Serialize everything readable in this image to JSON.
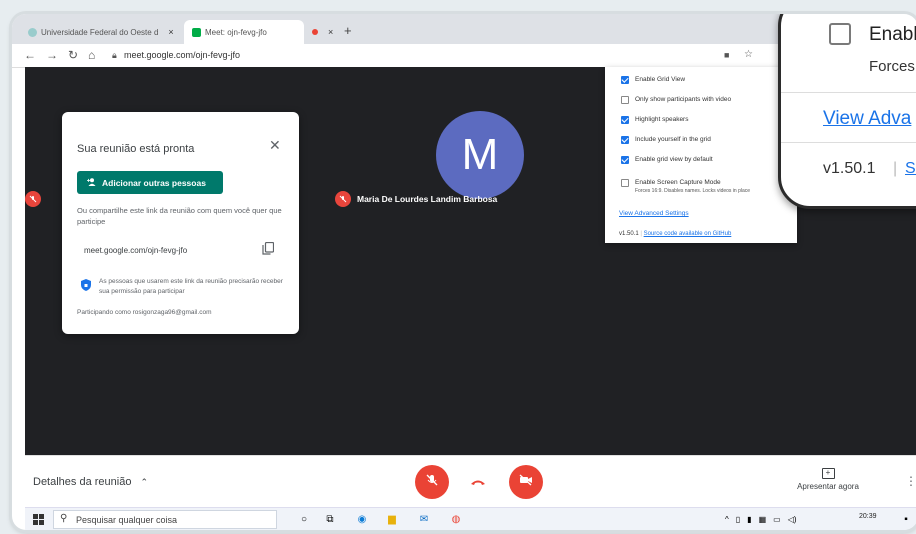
{
  "browser": {
    "tabs": [
      {
        "title": "Universidade Federal do Oeste d",
        "close": "×"
      },
      {
        "title": "Meet: ojn-fevg-jfo",
        "close": ""
      },
      {
        "title": "",
        "close": "×"
      }
    ],
    "new_tab": "+",
    "url": "meet.google.com/ojn-fevg-jfo"
  },
  "dialog": {
    "title": "Sua reunião está pronta",
    "add_button": "Adicionar outras pessoas",
    "share_text": "Ou compartilhe este link da reunião com quem você quer que participe",
    "meeting_link": "meet.google.com/ojn-fevg-jfo",
    "security_note": "As pessoas que usarem este link da reunião precisarão receber sua permissão para participar",
    "participating_as": "Participando como rosigonzaga96@gmail.com"
  },
  "participant": {
    "initial": "M",
    "name": "Maria De Lourdes Landim Barbosa"
  },
  "extension": {
    "options": [
      {
        "label": "Enable Grid View",
        "checked": true
      },
      {
        "label": "Only show participants with video",
        "checked": false
      },
      {
        "label": "Highlight speakers",
        "checked": true
      },
      {
        "label": "Include yourself in the grid",
        "checked": true
      },
      {
        "label": "Enable grid view by default",
        "checked": true
      },
      {
        "label": "Enable Screen Capture Mode",
        "checked": false,
        "sub": "Forces 16:9. Disables names. Locks videos in place"
      }
    ],
    "advanced_link": "View Advanced Settings",
    "version": "v1.50.1",
    "source_link": "Source code available on GitHub"
  },
  "zoom": {
    "enable": "Enabl",
    "forces": "Forces",
    "advanced": "View Adva",
    "version": "v1.50.1",
    "sep": "|",
    "source": "So"
  },
  "bottom_bar": {
    "details": "Detalhes da reunião",
    "present": "Apresentar agora"
  },
  "taskbar": {
    "search_placeholder": "Pesquisar qualquer coisa",
    "time": "20:39"
  },
  "colors": {
    "meet_bg": "#202124",
    "end_call": "#ea4335",
    "teal": "#00796b",
    "link": "#1a73e8",
    "avatar": "#5c6bc0"
  }
}
